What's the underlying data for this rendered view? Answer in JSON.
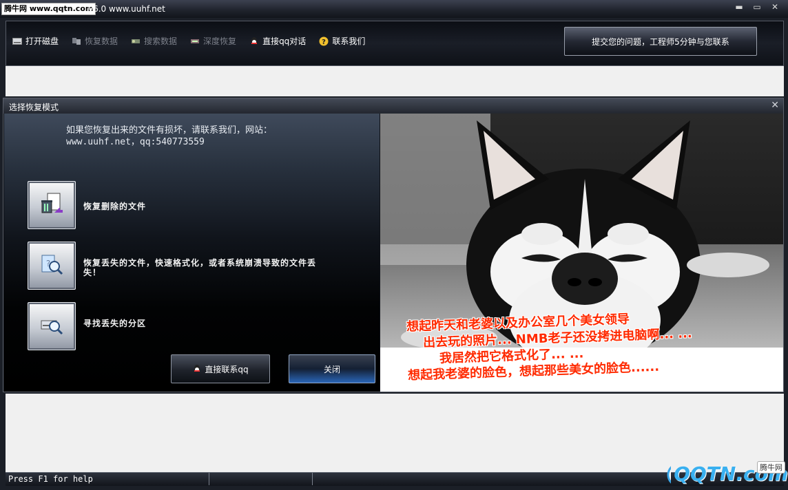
{
  "window": {
    "watermark": "腾牛网 www.qqtn.com",
    "title": "v6.0 www.uuhf.net",
    "minimize": "▬",
    "restore": "▭",
    "close": "✕"
  },
  "toolbar": {
    "items": [
      {
        "label": "打开磁盘",
        "icon": "disk-icon",
        "enabled": true
      },
      {
        "label": "恢复数据",
        "icon": "recover-icon",
        "enabled": false
      },
      {
        "label": "搜索数据",
        "icon": "search-data-icon",
        "enabled": false
      },
      {
        "label": "深度恢复",
        "icon": "deep-recover-icon",
        "enabled": false
      },
      {
        "label": "直接qq对话",
        "icon": "qq-icon",
        "enabled": true
      },
      {
        "label": "联系我们",
        "icon": "help-icon",
        "enabled": true
      }
    ],
    "submit_label": "提交您的问题，工程师5分钟与您联系"
  },
  "dialog": {
    "title": "选择恢复模式",
    "close": "✕",
    "notice": "如果您恢复出来的文件有损坏，请联系我们，网站：www.uuhf.net，qq:540773559",
    "options": [
      {
        "label": "恢复删除的文件",
        "icon": "recycle-file-icon"
      },
      {
        "label": "恢复丢失的文件，快速格式化，或者系统崩溃导致的文件丢失！",
        "icon": "file-search-icon"
      },
      {
        "label": "寻找丢失的分区",
        "icon": "partition-search-icon"
      }
    ],
    "qq_button": "直接联系qq",
    "close_button": "关闭",
    "image_caption": [
      "想起昨天和老婆以及办公室几个美女领导",
      "出去玩的照片... NMB老子还没拷进电脑啊... ...",
      "我居然把它格式化了... ...",
      "想起我老婆的脸色，想起那些美女的脸色......"
    ]
  },
  "statusbar": {
    "help": "Press F1 for help"
  },
  "watermark_br": {
    "logo": "QQTN.com",
    "tag": "腾牛网"
  }
}
